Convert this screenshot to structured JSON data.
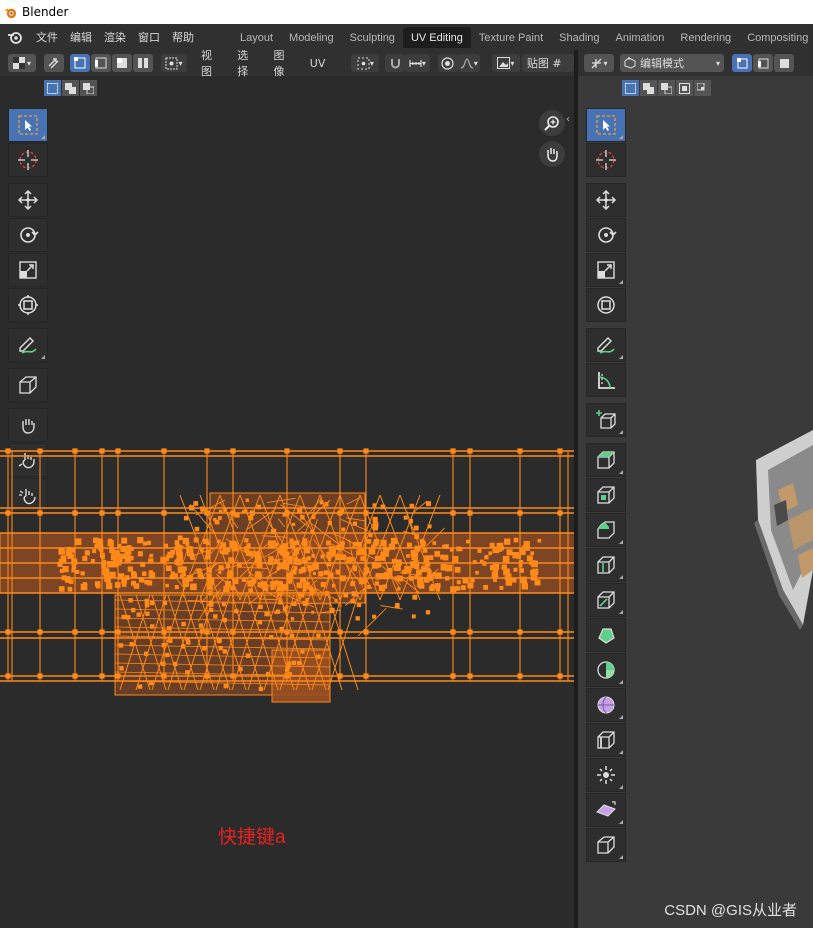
{
  "window": {
    "title": "Blender"
  },
  "menubar": {
    "items": [
      "文件",
      "编辑",
      "渲染",
      "窗口",
      "帮助"
    ]
  },
  "workspaces": {
    "tabs": [
      "Layout",
      "Modeling",
      "Sculpting",
      "UV Editing",
      "Texture Paint",
      "Shading",
      "Animation",
      "Rendering",
      "Compositing"
    ],
    "active": "UV Editing"
  },
  "uv_editor": {
    "header_menus": [
      "视图",
      "选择",
      "图像",
      "UV"
    ],
    "image_label": "贴图 #",
    "annotation": "快捷键a"
  },
  "viewport": {
    "mode": "编辑模式"
  },
  "watermark": "CSDN @GIS从业者",
  "colors": {
    "accent": "#4772b3",
    "uv_edge": "#ff8a1a",
    "uv_fill": "#9a4f22",
    "annotation": "#e8221f"
  }
}
